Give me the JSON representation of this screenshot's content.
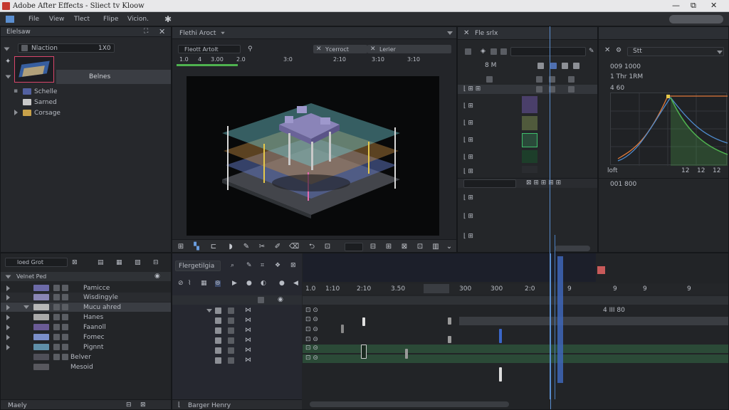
{
  "app": {
    "title": "Adobe After Effects - Sliect tv Kloow",
    "minimize": "—",
    "restore": "⧉",
    "close": "✕"
  },
  "menu": {
    "items": [
      "File",
      "View",
      "Tlect",
      "Flipe",
      "Vicion."
    ]
  },
  "project": {
    "header": "Elelsaw",
    "item_name": "Nlaction",
    "item_code": "1X0",
    "selected_label": "Belnes",
    "folders": [
      "Schelle",
      "Sarned",
      "Corsage"
    ]
  },
  "viewer": {
    "tab": "Flethi Aroct",
    "field_left": "Fleott Artolt",
    "tab_a": "Ycerroct",
    "tab_b": "Lerier",
    "ruler": [
      "1.0",
      "4",
      "3.00",
      "2.0",
      "3:0",
      "2:10",
      "3:10",
      "3:10"
    ]
  },
  "effects": {
    "tab": "Fle srlx",
    "row_label": "8 M"
  },
  "graph": {
    "header": "Stt",
    "label1": "009 1000",
    "label2": "1 Thr 1RM",
    "label3": "4 60",
    "foot_left": "loft",
    "foot_r1": "12",
    "foot_r2": "12",
    "foot_r3": "12",
    "lower_label": "001 800",
    "colors": {
      "orange": "#e07a3a",
      "blue": "#4f8ccf",
      "green": "#4fb24f"
    }
  },
  "layers": {
    "header_field": "loed Grot",
    "search_label": "Velnet Ped",
    "items": [
      "Pamicce",
      "Wisdingyle",
      "Mucu ahred",
      "Hanes",
      "Faanoll",
      "Fomec",
      "Pignnt",
      "Belver",
      "Mesoid"
    ],
    "footer": "Maely"
  },
  "timeline": {
    "tab": "Flergetilgia",
    "ruler": [
      "1.0",
      "1:10",
      "2:10",
      "3.50",
      "300",
      "300",
      "2:0",
      "9",
      "9",
      "9",
      "9"
    ],
    "marker_a": "4 III 80",
    "footer": "Barger Henry"
  },
  "comp": {
    "alt": "3D layered isometric platform"
  }
}
